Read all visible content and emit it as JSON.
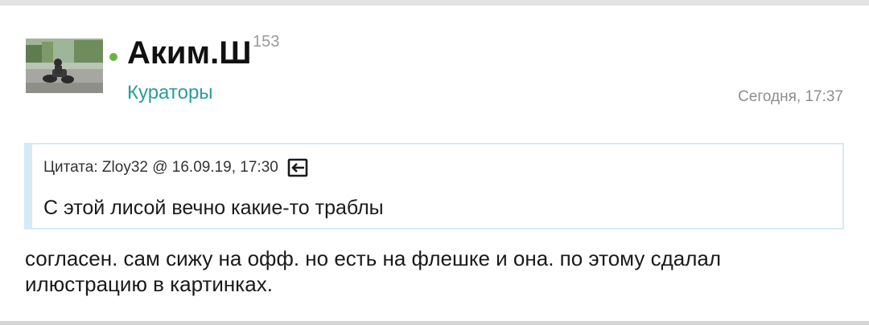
{
  "post": {
    "author": {
      "name": "Аким.Ш",
      "reputation": "153",
      "group": "Кураторы",
      "online": true,
      "status_color": "#6bb33f"
    },
    "time": "Сегодня, 17:37",
    "quote": {
      "header": "Цитата: Zloy32 @ 16.09.19, 17:30",
      "icon": "goto-post-icon",
      "text": "С этой лисой вечно какие-то траблы"
    },
    "body": "согласен. сам сижу на офф. но есть на флешке и она. по этому сдалал илюстрацию в картинках."
  },
  "colors": {
    "group_link": "#2a9d9a",
    "quote_border": "#d5eaf4",
    "timestamp": "#8d8d8d"
  }
}
